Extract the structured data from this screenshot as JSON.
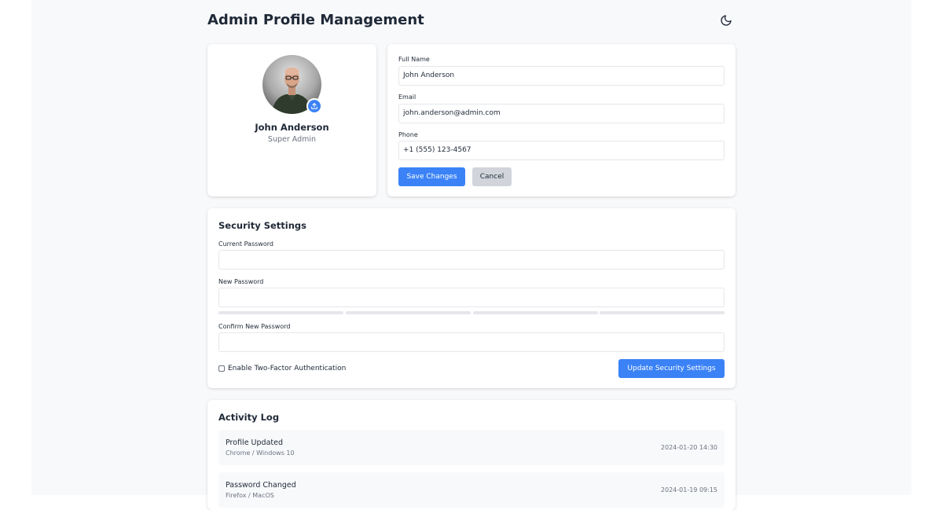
{
  "header": {
    "title": "Admin Profile Management",
    "theme_icon": "moon-icon"
  },
  "profile": {
    "name": "John Anderson",
    "role": "Super Admin",
    "upload_icon": "upload-icon"
  },
  "info_form": {
    "full_name_label": "Full Name",
    "full_name_value": "John Anderson",
    "email_label": "Email",
    "email_value": "john.anderson@admin.com",
    "phone_label": "Phone",
    "phone_value": "+1 (555) 123-4567",
    "save_label": "Save Changes",
    "cancel_label": "Cancel"
  },
  "security": {
    "title": "Security Settings",
    "current_password_label": "Current Password",
    "current_password_value": "",
    "new_password_label": "New Password",
    "new_password_value": "",
    "confirm_password_label": "Confirm New Password",
    "confirm_password_value": "",
    "strength_level": 0,
    "two_factor_label": "Enable Two-Factor Authentication",
    "two_factor_enabled": false,
    "update_label": "Update Security Settings"
  },
  "activity": {
    "title": "Activity Log",
    "items": [
      {
        "title": "Profile Updated",
        "device": "Chrome / Windows 10",
        "time": "2024-01-20 14:30"
      },
      {
        "title": "Password Changed",
        "device": "Firefox / MacOS",
        "time": "2024-01-19 09:15"
      }
    ]
  },
  "colors": {
    "accent": "#3b82f6",
    "secondary_button": "#d1d5db",
    "page_bg": "#f8f9fb"
  }
}
